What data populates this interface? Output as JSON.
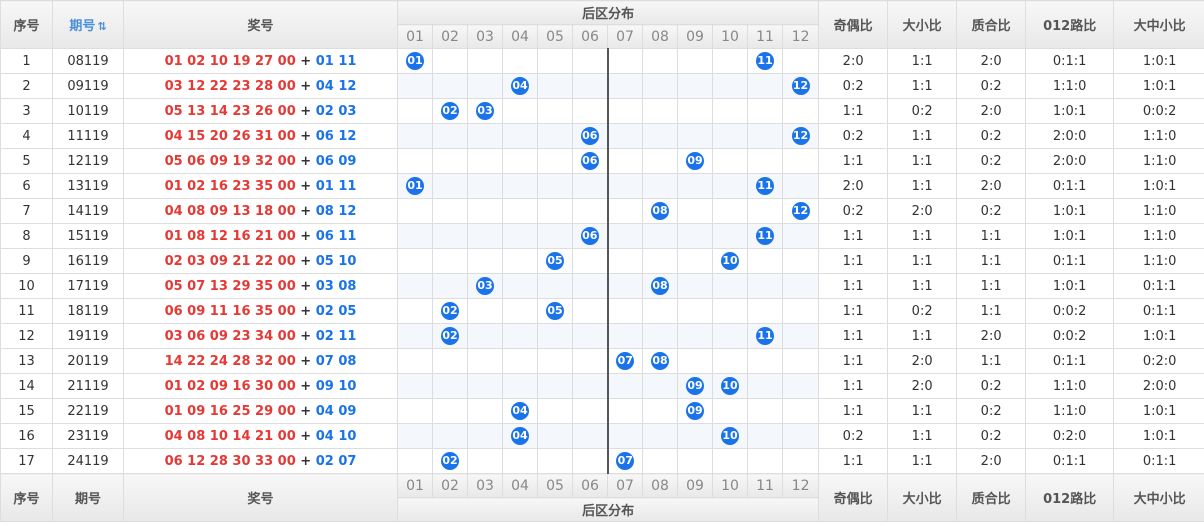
{
  "header": {
    "index": "序号",
    "issue": "期号",
    "draw": "奖号",
    "back_dist": "后区分布",
    "ratios": [
      "奇偶比",
      "大小比",
      "质合比",
      "012路比",
      "大中小比"
    ],
    "nums": [
      "01",
      "02",
      "03",
      "04",
      "05",
      "06",
      "07",
      "08",
      "09",
      "10",
      "11",
      "12"
    ]
  },
  "rows": [
    {
      "idx": "1",
      "issue": "08119",
      "front": "01 02 10 19 27 00",
      "back": "01 11",
      "balls": [
        "01",
        "11"
      ],
      "r": [
        "2:0",
        "1:1",
        "2:0",
        "0:1:1",
        "1:0:1"
      ]
    },
    {
      "idx": "2",
      "issue": "09119",
      "front": "03 12 22 23 28 00",
      "back": "04 12",
      "balls": [
        "04",
        "12"
      ],
      "r": [
        "0:2",
        "1:1",
        "0:2",
        "1:1:0",
        "1:0:1"
      ]
    },
    {
      "idx": "3",
      "issue": "10119",
      "front": "05 13 14 23 26 00",
      "back": "02 03",
      "balls": [
        "02",
        "03"
      ],
      "r": [
        "1:1",
        "0:2",
        "2:0",
        "1:0:1",
        "0:0:2"
      ]
    },
    {
      "idx": "4",
      "issue": "11119",
      "front": "04 15 20 26 31 00",
      "back": "06 12",
      "balls": [
        "06",
        "12"
      ],
      "r": [
        "0:2",
        "1:1",
        "0:2",
        "2:0:0",
        "1:1:0"
      ]
    },
    {
      "idx": "5",
      "issue": "12119",
      "front": "05 06 09 19 32 00",
      "back": "06 09",
      "balls": [
        "06",
        "09"
      ],
      "r": [
        "1:1",
        "1:1",
        "0:2",
        "2:0:0",
        "1:1:0"
      ]
    },
    {
      "idx": "6",
      "issue": "13119",
      "front": "01 02 16 23 35 00",
      "back": "01 11",
      "balls": [
        "01",
        "11"
      ],
      "r": [
        "2:0",
        "1:1",
        "2:0",
        "0:1:1",
        "1:0:1"
      ]
    },
    {
      "idx": "7",
      "issue": "14119",
      "front": "04 08 09 13 18 00",
      "back": "08 12",
      "balls": [
        "08",
        "12"
      ],
      "r": [
        "0:2",
        "2:0",
        "0:2",
        "1:0:1",
        "1:1:0"
      ]
    },
    {
      "idx": "8",
      "issue": "15119",
      "front": "01 08 12 16 21 00",
      "back": "06 11",
      "balls": [
        "06",
        "11"
      ],
      "r": [
        "1:1",
        "1:1",
        "1:1",
        "1:0:1",
        "1:1:0"
      ]
    },
    {
      "idx": "9",
      "issue": "16119",
      "front": "02 03 09 21 22 00",
      "back": "05 10",
      "balls": [
        "05",
        "10"
      ],
      "r": [
        "1:1",
        "1:1",
        "1:1",
        "0:1:1",
        "1:1:0"
      ]
    },
    {
      "idx": "10",
      "issue": "17119",
      "front": "05 07 13 29 35 00",
      "back": "03 08",
      "balls": [
        "03",
        "08"
      ],
      "r": [
        "1:1",
        "1:1",
        "1:1",
        "1:0:1",
        "0:1:1"
      ]
    },
    {
      "idx": "11",
      "issue": "18119",
      "front": "06 09 11 16 35 00",
      "back": "02 05",
      "balls": [
        "02",
        "05"
      ],
      "r": [
        "1:1",
        "0:2",
        "1:1",
        "0:0:2",
        "0:1:1"
      ]
    },
    {
      "idx": "12",
      "issue": "19119",
      "front": "03 06 09 23 34 00",
      "back": "02 11",
      "balls": [
        "02",
        "11"
      ],
      "r": [
        "1:1",
        "1:1",
        "2:0",
        "0:0:2",
        "1:0:1"
      ]
    },
    {
      "idx": "13",
      "issue": "20119",
      "front": "14 22 24 28 32 00",
      "back": "07 08",
      "balls": [
        "07",
        "08"
      ],
      "r": [
        "1:1",
        "2:0",
        "1:1",
        "0:1:1",
        "0:2:0"
      ]
    },
    {
      "idx": "14",
      "issue": "21119",
      "front": "01 02 09 16 30 00",
      "back": "09 10",
      "balls": [
        "09",
        "10"
      ],
      "r": [
        "1:1",
        "2:0",
        "0:2",
        "1:1:0",
        "2:0:0"
      ]
    },
    {
      "idx": "15",
      "issue": "22119",
      "front": "01 09 16 25 29 00",
      "back": "04 09",
      "balls": [
        "04",
        "09"
      ],
      "r": [
        "1:1",
        "1:1",
        "0:2",
        "1:1:0",
        "1:0:1"
      ]
    },
    {
      "idx": "16",
      "issue": "23119",
      "front": "04 08 10 14 21 00",
      "back": "04 10",
      "balls": [
        "04",
        "10"
      ],
      "r": [
        "0:2",
        "1:1",
        "0:2",
        "0:2:0",
        "1:0:1"
      ]
    },
    {
      "idx": "17",
      "issue": "24119",
      "front": "06 12 28 30 33 00",
      "back": "02 07",
      "balls": [
        "02",
        "07"
      ],
      "r": [
        "1:1",
        "1:1",
        "2:0",
        "0:1:1",
        "0:1:1"
      ]
    }
  ],
  "colors": {
    "ball": "#1a73e8",
    "front": "#e53935",
    "back": "#1a73e8"
  },
  "icons": {
    "sort": "sort-icon"
  }
}
